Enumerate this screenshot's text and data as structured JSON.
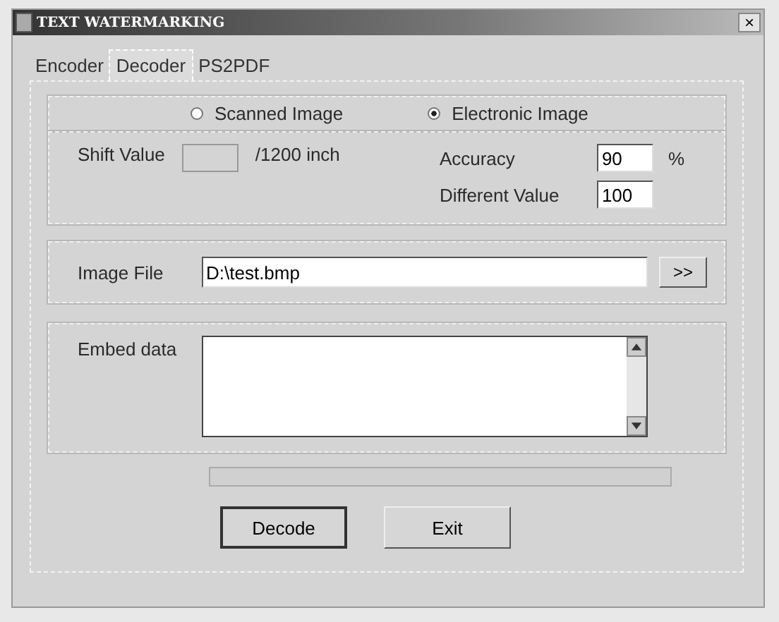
{
  "window": {
    "title": "TEXT WATERMARKING",
    "close": "×"
  },
  "tabs": [
    {
      "label": "Encoder",
      "selected": false
    },
    {
      "label": "Decoder",
      "selected": true
    },
    {
      "label": "PS2PDF",
      "selected": false
    }
  ],
  "source": [
    {
      "label": "Scanned Image",
      "selected": false
    },
    {
      "label": "Electronic Image",
      "selected": true
    }
  ],
  "shift": {
    "label": "Shift Value",
    "disabled": true,
    "unit": "/1200 inch"
  },
  "accuracy": {
    "label": "Accuracy",
    "value": "90",
    "unit": "%"
  },
  "difference": {
    "label": "Different Value",
    "value": "100"
  },
  "image_file": {
    "label": "Image File",
    "value": "D:\\test.bmp",
    "browse": ">>"
  },
  "embed": {
    "label": "Embed data"
  },
  "progress": {
    "level": 0
  },
  "buttons": [
    {
      "label": "Decode",
      "default": true
    },
    {
      "label": "Exit",
      "default": false
    }
  ]
}
